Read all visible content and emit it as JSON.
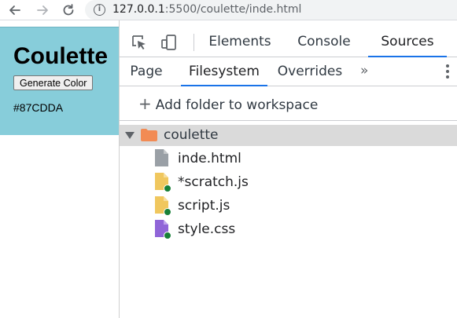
{
  "browser": {
    "back_icon": "arrow-left-icon",
    "forward_icon": "arrow-right-icon",
    "reload_icon": "reload-icon",
    "url_host": "127.0.0.1",
    "url_rest": ":5500/coulette/inde.html"
  },
  "page": {
    "title": "Coulette",
    "button_label": "Generate Color",
    "color_value": "#87CDDA",
    "background_color": "#87CDDA"
  },
  "devtools": {
    "tabs": [
      {
        "label": "Elements",
        "active": false
      },
      {
        "label": "Console",
        "active": false
      },
      {
        "label": "Sources",
        "active": true
      }
    ],
    "sub_tabs": [
      {
        "label": "Page",
        "active": false
      },
      {
        "label": "Filesystem",
        "active": true
      },
      {
        "label": "Overrides",
        "active": false
      }
    ],
    "more_tabs": "»",
    "add_folder_label": "Add folder to workspace",
    "folder": {
      "name": "coulette",
      "expanded": true
    },
    "files": [
      {
        "name": "inde.html",
        "type": "html",
        "color": "#9aa0a6",
        "has_status": false
      },
      {
        "name": "*scratch.js",
        "type": "js",
        "color": "#f0c75e",
        "has_status": true
      },
      {
        "name": "script.js",
        "type": "js",
        "color": "#f0c75e",
        "has_status": true
      },
      {
        "name": "style.css",
        "type": "css",
        "color": "#9065d8",
        "has_status": true
      }
    ],
    "accent_color": "#1A73E8"
  }
}
